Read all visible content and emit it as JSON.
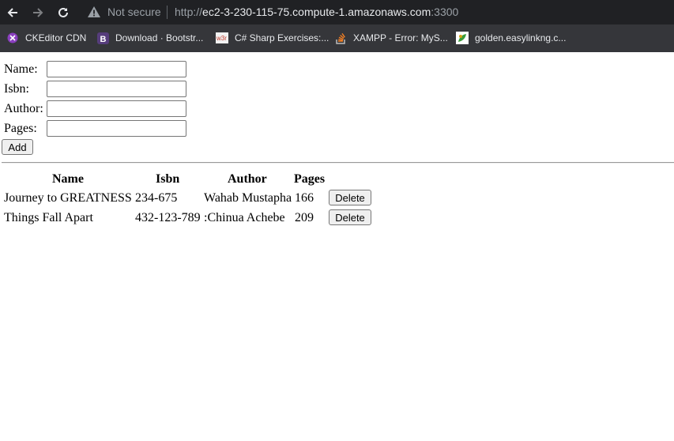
{
  "browser": {
    "security_label": "Not secure",
    "url_scheme": "http://",
    "url_host": "ec2-3-230-115-75.compute-1.amazonaws.com",
    "url_port": ":3300",
    "bookmarks": [
      {
        "label": "CKEditor CDN",
        "icon": "ckeditor-icon"
      },
      {
        "label": "Download · Bootstr...",
        "icon": "bootstrap-icon"
      },
      {
        "label": "C# Sharp Exercises:...",
        "icon": "w3resource-icon"
      },
      {
        "label": "XAMPP - Error: MyS...",
        "icon": "stackoverflow-icon"
      },
      {
        "label": "golden.easylinkng.c...",
        "icon": "site-icon"
      }
    ]
  },
  "form": {
    "name_label": "Name:",
    "isbn_label": "Isbn:",
    "author_label": "Author:",
    "pages_label": "Pages:",
    "name_value": "",
    "isbn_value": "",
    "author_value": "",
    "pages_value": "",
    "add_label": "Add"
  },
  "table": {
    "headers": [
      "Name",
      "Isbn",
      "Author",
      "Pages"
    ],
    "rows": [
      {
        "name": "Journey to GREATNESS",
        "isbn": "234-675",
        "author": "Wahab Mustapha",
        "pages": "166",
        "action": "Delete"
      },
      {
        "name": "Things Fall Apart",
        "isbn": "432-123-789",
        "author": ":Chinua Achebe",
        "pages": "209",
        "action": "Delete"
      }
    ]
  }
}
